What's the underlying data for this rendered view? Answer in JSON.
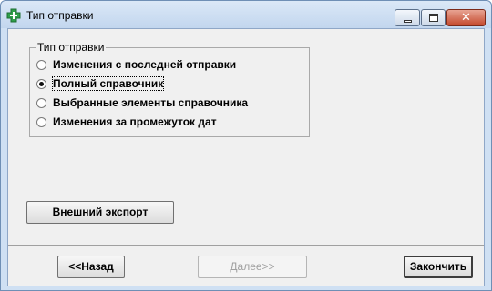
{
  "window": {
    "title": "Тип отправки",
    "icon": "green-cross-plus-icon",
    "controls": {
      "minimize": "minimize-icon",
      "maximize": "maximize-icon",
      "close": "✕"
    }
  },
  "group": {
    "legend": "Тип отправки",
    "options": [
      {
        "label": "Изменения с последней отправки",
        "selected": false
      },
      {
        "label": "Полный справочник",
        "selected": true
      },
      {
        "label": "Выбранные элементы справочника",
        "selected": false
      },
      {
        "label": "Изменения за промежуток дат",
        "selected": false
      }
    ]
  },
  "buttons": {
    "export": "Внешний экспорт",
    "back": "<<Назад",
    "next": "Далее>>",
    "finish": "Закончить"
  },
  "colors": {
    "window_frame": "#cfe0f3",
    "client_bg": "#f0f0f0",
    "close_button": "#c4492d",
    "app_icon_green": "#2fa04a"
  }
}
